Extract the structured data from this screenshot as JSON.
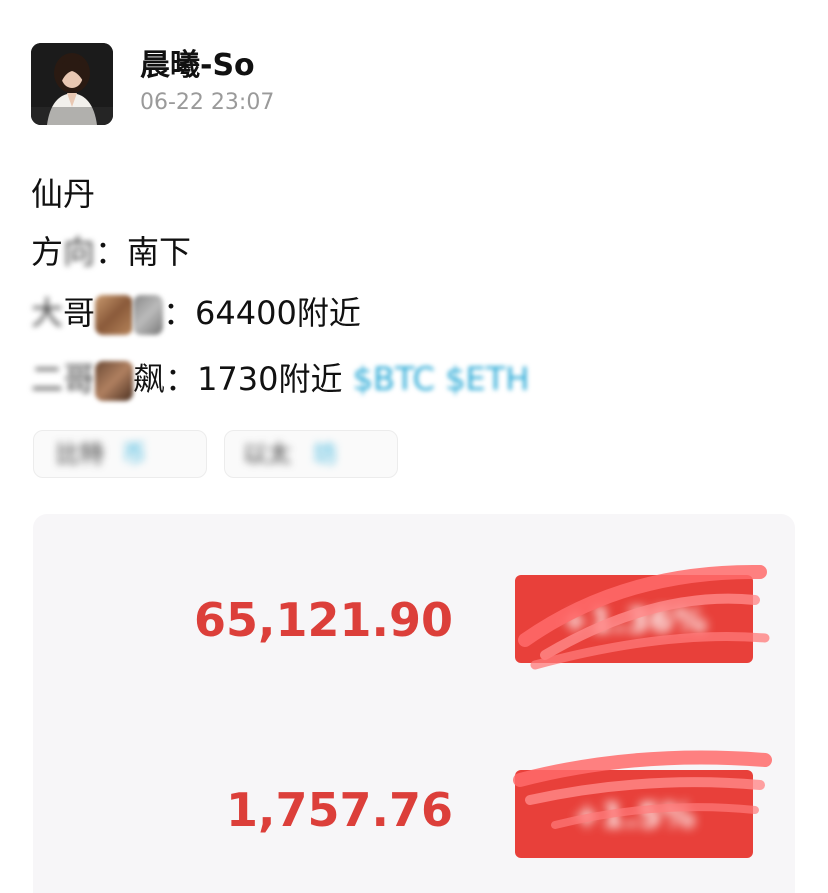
{
  "post": {
    "author": {
      "name": "晨曦-So",
      "avatar_icon": "person-avatar-icon"
    },
    "timestamp": "06-22 23:07",
    "lines": {
      "title": "仙丹",
      "direction_label": "方",
      "direction_colon": "：",
      "direction_value": "南下",
      "btc_prefix": "大",
      "btc_mid": "哥",
      "btc_colon": "：",
      "btc_value": "64400附近",
      "eth_prefix": "二",
      "eth_mid": "飙",
      "eth_colon": "：",
      "eth_value": "1730附近",
      "ticker_btc": "$BTC",
      "ticker_eth": "$ETH"
    },
    "tags": [
      {
        "label_dark": "比特",
        "label_blue": "币"
      },
      {
        "label_dark": "以太",
        "label_blue": "坊"
      }
    ]
  },
  "prices": [
    {
      "value": "65,121.90",
      "change": "+1.36%"
    },
    {
      "value": "1,757.76",
      "change": "+1.5%"
    }
  ],
  "colors": {
    "price_red": "#dc3f3a",
    "badge_red": "#e8403a",
    "link_blue": "#28a9d6",
    "timestamp_grey": "#9a9a9a"
  }
}
